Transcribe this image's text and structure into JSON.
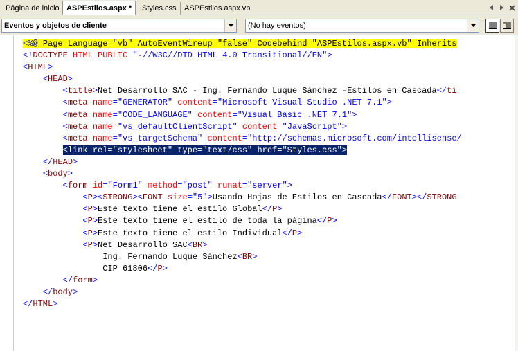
{
  "tabs": [
    {
      "label": "Página de inicio",
      "active": false
    },
    {
      "label": "ASPEstilos.aspx *",
      "active": true
    },
    {
      "label": "Styles.css",
      "active": false
    },
    {
      "label": "ASPEstilos.aspx.vb",
      "active": false
    }
  ],
  "tab_controls": [
    "arrow-left-icon",
    "arrow-right-icon",
    "close-icon"
  ],
  "combos": {
    "objects": "Eventos y objetos de cliente",
    "events": "(No hay eventos)"
  },
  "colors": {
    "keyword": "#0000ff",
    "tag": "#800000",
    "attribute": "#ff0000",
    "directive_bg": "#ffff00",
    "selection_bg": "#0a246a"
  },
  "code": {
    "l1": {
      "a": "<%@ ",
      "b": "Page Language=\"vb\" AutoEventWireup=\"false\" Codebehind=\"ASPEstilos.aspx.vb\" Inherits"
    },
    "l2": {
      "a": "<!",
      "b": "DOCTYPE ",
      "c": "HTML ",
      "d": "PUBLIC ",
      "e": "\"-//W3C//DTD HTML 4.0 Transitional//EN\"",
      "f": ">"
    },
    "l3": {
      "a": "<",
      "b": "HTML",
      "c": ">"
    },
    "l4": {
      "a": "<",
      "b": "HEAD",
      "c": ">"
    },
    "l5": {
      "a": "<",
      "b": "title",
      "c": ">",
      "d": "Net Desarrollo SAC - Ing. Fernando Luque Sánchez -Estilos en Cascada",
      "e": "</",
      "f": "ti"
    },
    "l6": {
      "a": "<",
      "b": "meta ",
      "c": "name",
      "d": "=",
      "e": "\"GENERATOR\" ",
      "f": "content",
      "g": "=",
      "h": "\"Microsoft Visual Studio .NET 7.1\"",
      "i": ">"
    },
    "l7": {
      "a": "<",
      "b": "meta ",
      "c": "name",
      "d": "=",
      "e": "\"CODE_LANGUAGE\" ",
      "f": "content",
      "g": "=",
      "h": "\"Visual Basic .NET 7.1\"",
      "i": ">"
    },
    "l8": {
      "a": "<",
      "b": "meta ",
      "c": "name",
      "d": "=",
      "e": "\"vs_defaultClientScript\" ",
      "f": "content",
      "g": "=",
      "h": "\"JavaScript\"",
      "i": ">"
    },
    "l9": {
      "a": "<",
      "b": "meta ",
      "c": "name",
      "d": "=",
      "e": "\"vs_targetSchema\" ",
      "f": "content",
      "g": "=",
      "h": "\"http://schemas.microsoft.com/intellisense/"
    },
    "l10": {
      "text": "<link rel=\"stylesheet\" type=\"text/css\" href=\"Styles.css\">"
    },
    "l11": {
      "a": "</",
      "b": "HEAD",
      "c": ">"
    },
    "l12": {
      "a": "<",
      "b": "body",
      "c": ">"
    },
    "l13": {
      "a": "<",
      "b": "form ",
      "c": "id",
      "d": "=",
      "e": "\"Form1\" ",
      "f": "method",
      "g": "=",
      "h": "\"post\" ",
      "i": "runat",
      "j": "=",
      "k": "\"server\"",
      "l": ">"
    },
    "l14": {
      "a": "<",
      "b": "P",
      "c": "><",
      "d": "STRONG",
      "e": "><",
      "f": "FONT ",
      "g": "size",
      "h": "=",
      "i": "\"5\"",
      "j": ">",
      "k": "Usando Hojas de Estilos en Cascada",
      "l": "</",
      "m": "FONT",
      "n": "></",
      "o": "STRONG"
    },
    "l15": {
      "a": "<",
      "b": "P",
      "c": ">",
      "d": "Este texto tiene el estilo Global",
      "e": "</",
      "f": "P",
      "g": ">"
    },
    "l16": {
      "a": "<",
      "b": "P",
      "c": ">",
      "d": "Este texto tiene el estilo de toda la página",
      "e": "</",
      "f": "P",
      "g": ">"
    },
    "l17": {
      "a": "<",
      "b": "P",
      "c": ">",
      "d": "Este texto tiene el estilo Individual",
      "e": "</",
      "f": "P",
      "g": ">"
    },
    "l18": {
      "a": "<",
      "b": "P",
      "c": ">",
      "d": "Net Desarrollo SAC",
      "e": "<",
      "f": "BR",
      "g": ">"
    },
    "l19": {
      "a": "Ing. Fernando Luque Sánchez",
      "b": "<",
      "c": "BR",
      "d": ">"
    },
    "l20": {
      "a": "CIP 61806",
      "b": "</",
      "c": "P",
      "d": ">"
    },
    "l21": {
      "a": "</",
      "b": "form",
      "c": ">"
    },
    "l22": {
      "a": "</",
      "b": "body",
      "c": ">"
    },
    "l23": {
      "a": "</",
      "b": "HTML",
      "c": ">"
    }
  }
}
